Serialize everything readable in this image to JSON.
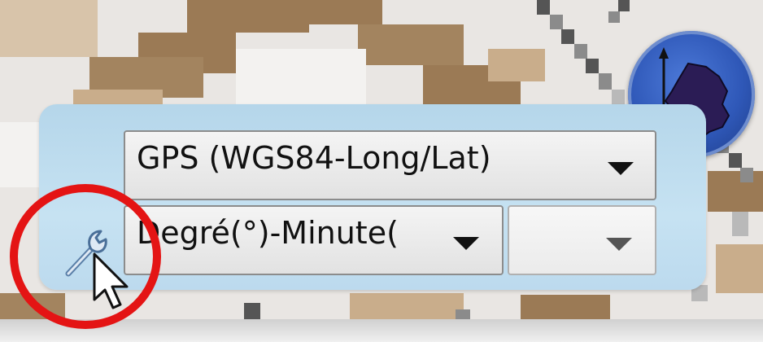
{
  "coordinate_system": {
    "selected": "GPS (WGS84-Long/Lat)",
    "arrow_icon": "triangle-down"
  },
  "unit_format": {
    "selected": "Degré(°)-Minute(",
    "arrow_icon": "triangle-down"
  },
  "extra_select": {
    "selected": "",
    "arrow_icon": "triangle-down"
  },
  "icons": {
    "settings": "wrench-icon",
    "compass": "france-map-compass-icon",
    "pointer": "mouse-cursor-icon"
  },
  "colors": {
    "panel": "#c6e2f2",
    "highlight_circle": "#e41414",
    "globe": "#2f58b8",
    "map_brown": "#9b7a55"
  }
}
